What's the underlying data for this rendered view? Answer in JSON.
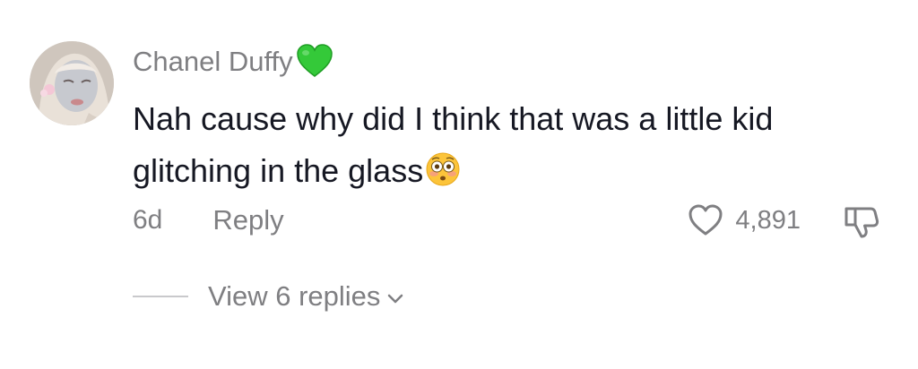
{
  "comment": {
    "author": {
      "name": "Chanel Duffy",
      "badge_icon": "green-heart-emoji",
      "avatar_icon": "profile-photo"
    },
    "text_line1": "Nah cause why did I think that was a little kid",
    "text_line2": "glitching in the glass",
    "text_emoji_icon": "flushed-face-emoji",
    "timestamp": "6d",
    "reply_label": "Reply",
    "likes": {
      "count": "4,891",
      "icon": "heart-outline-icon"
    },
    "dislike_icon": "thumbs-down-icon"
  },
  "replies": {
    "label": "View 6 replies",
    "icon": "chevron-down-icon"
  },
  "colors": {
    "primary_text": "#161823",
    "secondary_text": "#7f7f82",
    "divider": "#c9c9cc",
    "badge_green": "#33cc33"
  }
}
